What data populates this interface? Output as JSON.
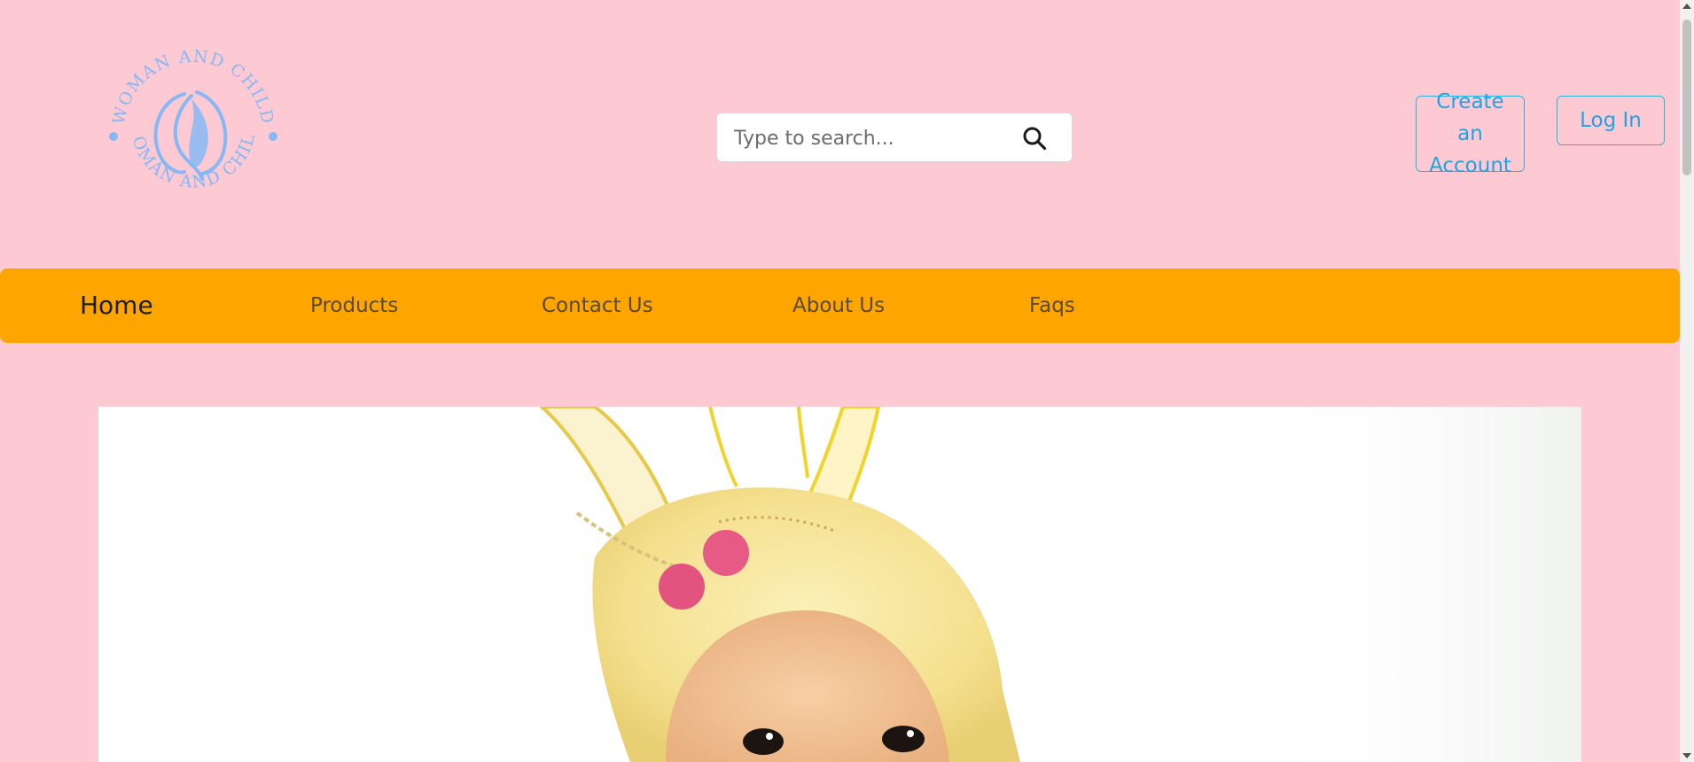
{
  "brand": {
    "logo_text_top": "WOMAN AND CHILD",
    "logo_text_bottom": "WOMAN AND CHILD",
    "logo_color": "#86b8f4"
  },
  "search": {
    "placeholder": "Type to search...",
    "value": "",
    "icon": "search-icon"
  },
  "auth": {
    "create_account_label": "Create an Account",
    "login_label": "Log In",
    "accent_color": "#1fa4e3"
  },
  "nav": {
    "items": [
      {
        "label": "Home",
        "active": true
      },
      {
        "label": "Products",
        "active": false
      },
      {
        "label": "Contact Us",
        "active": false
      },
      {
        "label": "About Us",
        "active": false
      },
      {
        "label": "Faqs",
        "active": false
      }
    ],
    "background_color": "#ffa500"
  },
  "page": {
    "background_color": "#fdc9d3"
  },
  "hero": {
    "image_subject": "baby-in-yellow-bunny-hood"
  }
}
